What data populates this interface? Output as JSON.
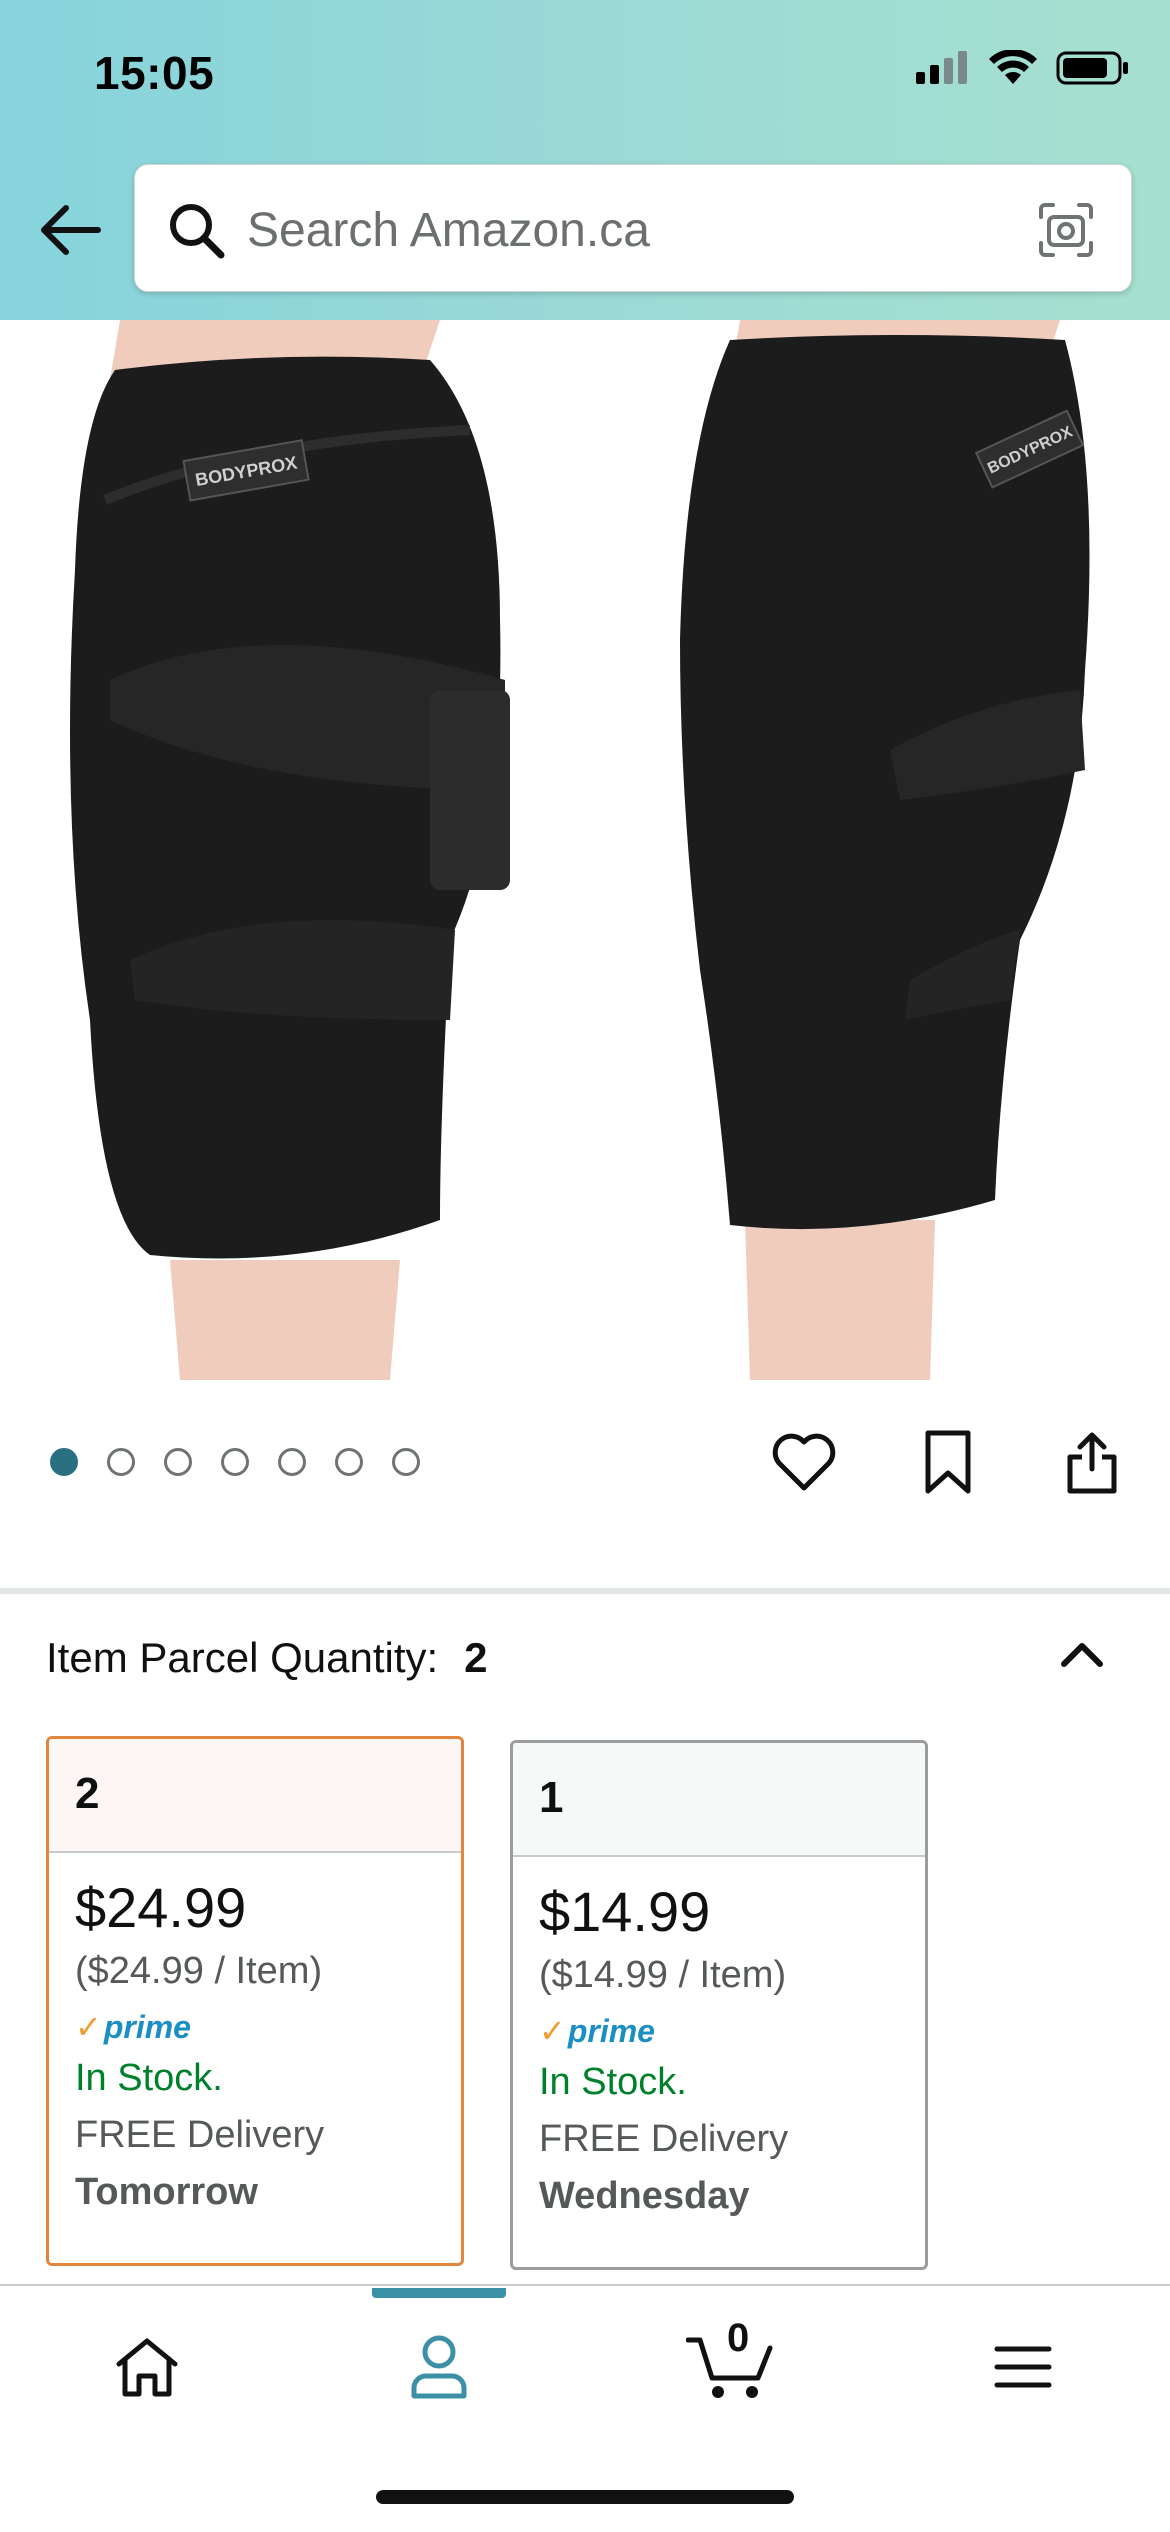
{
  "status_bar": {
    "time": "15:05"
  },
  "search": {
    "placeholder": "Search Amazon.ca"
  },
  "product": {
    "brand_label": "BODYPROX",
    "image_count": 7,
    "active_image_index": 0
  },
  "quantity": {
    "label": "Item Parcel Quantity:",
    "selected_value": "2",
    "options": [
      {
        "qty": "2",
        "price": "$24.99",
        "per_item": "($24.99 / Item)",
        "prime": "prime",
        "stock": "In Stock.",
        "delivery": "FREE Delivery",
        "delivery_day": "Tomorrow",
        "selected": true
      },
      {
        "qty": "1",
        "price": "$14.99",
        "per_item": "($14.99 / Item)",
        "prime": "prime",
        "stock": "In Stock.",
        "delivery": "FREE Delivery",
        "delivery_day": "Wednesday",
        "selected": false
      }
    ]
  },
  "bottom_nav": {
    "items": [
      "home-icon",
      "account-icon",
      "cart-icon",
      "menu-icon"
    ],
    "active": "account-icon",
    "cart_count": "0"
  },
  "colors": {
    "header_gradient_start": "#86d3dc",
    "header_gradient_end": "#a6e0cf",
    "selected_border": "#e2863f",
    "in_stock": "#00802a",
    "prime_blue": "#1b8ec4",
    "active_nav": "#3c90a5"
  }
}
